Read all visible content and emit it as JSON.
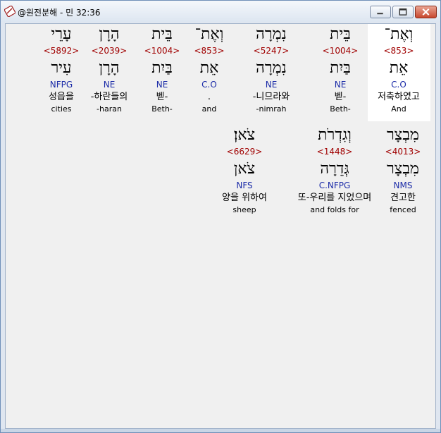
{
  "window": {
    "title": "@원전분해 - 민 32:36"
  },
  "icons": {
    "app": "app-icon",
    "minimize": "minimize-icon",
    "maximize": "maximize-icon",
    "close": "close-icon"
  },
  "colors": {
    "strong": "#a00000",
    "parse": "#1c2ca8",
    "highlight": "#ffffff"
  },
  "row1": [
    {
      "heb": "וְאֶת־",
      "strong": "<853>",
      "lemma": "אֵת",
      "parse": "C.O",
      "kor": "저축하였고",
      "eng": "And",
      "selected": true
    },
    {
      "heb": "בֵּית",
      "strong": "<1004>",
      "lemma": "בַּיִת",
      "parse": "NE",
      "kor": "벧-",
      "eng": "Beth-"
    },
    {
      "heb": "נִמְרָה",
      "strong": "<5247>",
      "lemma": "נִמְרָה",
      "parse": "NE",
      "kor": "-니므라와",
      "eng": "-nimrah"
    },
    {
      "heb": "וְאֶת־",
      "strong": "<853>",
      "lemma": "אֵת",
      "parse": "C.O",
      "kor": ".",
      "eng": "and"
    },
    {
      "heb": "בֵּית",
      "strong": "<1004>",
      "lemma": "בַּיִת",
      "parse": "NE",
      "kor": "벧-",
      "eng": "Beth-"
    },
    {
      "heb": "הָרָן",
      "strong": "<2039>",
      "lemma": "הָרָן",
      "parse": "NE",
      "kor": "-하란들의",
      "eng": "-haran"
    },
    {
      "heb": "עָרֵי",
      "strong": "<5892>",
      "lemma": "עִיר",
      "parse": "NFPG",
      "kor": "성읍을",
      "eng": "cities"
    }
  ],
  "row2": [
    {
      "heb": "מִבְצָר",
      "strong": "<4013>",
      "lemma": "מִבְצָר",
      "parse": "NMS",
      "kor": "견고한",
      "eng": "fenced"
    },
    {
      "heb": "וְגִדְרֹת",
      "strong": "<1448>",
      "lemma": "גְּדֵרָה",
      "parse": "C.NFPG",
      "kor": "또-우리를 지었으며",
      "eng": "and folds for"
    },
    {
      "heb": "צֹאן׃",
      "strong": "<6629>",
      "lemma": "צֹאן",
      "parse": "NFS",
      "kor": "양을 위하여",
      "eng": "sheep"
    }
  ]
}
